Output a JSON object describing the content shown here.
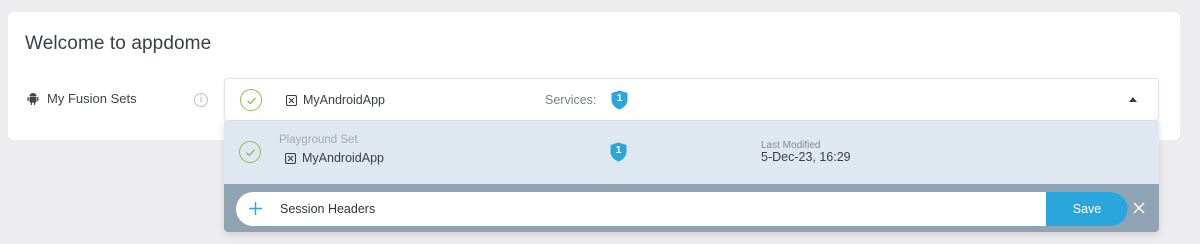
{
  "page": {
    "title": "Welcome to appdome"
  },
  "fusion_sets": {
    "label": "My Fusion Sets",
    "info_icon_glyph": "i",
    "selected": {
      "app_name": "MyAndroidApp",
      "services_label": "Services:",
      "services_count": "1"
    },
    "options": [
      {
        "set_name": "Playground Set",
        "app_name": "MyAndroidApp",
        "services_count": "1",
        "last_modified_label": "Last Modified",
        "last_modified_value": "5-Dec-23, 16:29"
      }
    ],
    "add_new": {
      "value": "Session Headers",
      "save_label": "Save"
    }
  },
  "icons": {
    "android": "android-icon",
    "info": "info-icon",
    "check": "check-circle-icon",
    "app": "app-icon",
    "shield": "shield-icon",
    "caret": "caret-up-icon",
    "plus": "plus-icon",
    "close": "close-icon"
  },
  "colors": {
    "check_green": "#8cc152",
    "shield_blue": "#29a7dc",
    "save_blue": "#29a7dc",
    "option_bg": "#dfe7f0",
    "dropdown_footer_bg": "#8fa3b3"
  }
}
